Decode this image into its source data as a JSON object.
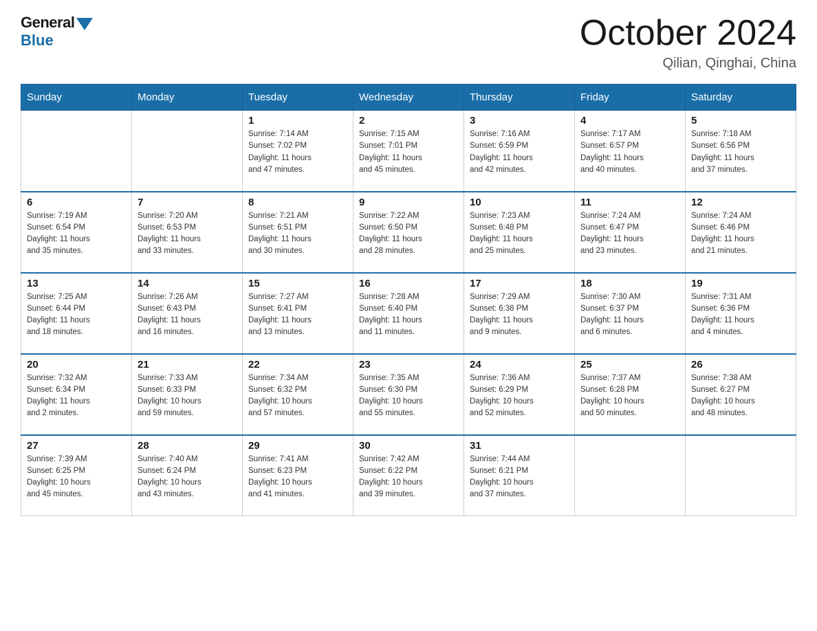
{
  "header": {
    "logo_general": "General",
    "logo_blue": "Blue",
    "month_title": "October 2024",
    "location": "Qilian, Qinghai, China"
  },
  "days_of_week": [
    "Sunday",
    "Monday",
    "Tuesday",
    "Wednesday",
    "Thursday",
    "Friday",
    "Saturday"
  ],
  "weeks": [
    [
      {
        "day": "",
        "info": ""
      },
      {
        "day": "",
        "info": ""
      },
      {
        "day": "1",
        "info": "Sunrise: 7:14 AM\nSunset: 7:02 PM\nDaylight: 11 hours\nand 47 minutes."
      },
      {
        "day": "2",
        "info": "Sunrise: 7:15 AM\nSunset: 7:01 PM\nDaylight: 11 hours\nand 45 minutes."
      },
      {
        "day": "3",
        "info": "Sunrise: 7:16 AM\nSunset: 6:59 PM\nDaylight: 11 hours\nand 42 minutes."
      },
      {
        "day": "4",
        "info": "Sunrise: 7:17 AM\nSunset: 6:57 PM\nDaylight: 11 hours\nand 40 minutes."
      },
      {
        "day": "5",
        "info": "Sunrise: 7:18 AM\nSunset: 6:56 PM\nDaylight: 11 hours\nand 37 minutes."
      }
    ],
    [
      {
        "day": "6",
        "info": "Sunrise: 7:19 AM\nSunset: 6:54 PM\nDaylight: 11 hours\nand 35 minutes."
      },
      {
        "day": "7",
        "info": "Sunrise: 7:20 AM\nSunset: 6:53 PM\nDaylight: 11 hours\nand 33 minutes."
      },
      {
        "day": "8",
        "info": "Sunrise: 7:21 AM\nSunset: 6:51 PM\nDaylight: 11 hours\nand 30 minutes."
      },
      {
        "day": "9",
        "info": "Sunrise: 7:22 AM\nSunset: 6:50 PM\nDaylight: 11 hours\nand 28 minutes."
      },
      {
        "day": "10",
        "info": "Sunrise: 7:23 AM\nSunset: 6:48 PM\nDaylight: 11 hours\nand 25 minutes."
      },
      {
        "day": "11",
        "info": "Sunrise: 7:24 AM\nSunset: 6:47 PM\nDaylight: 11 hours\nand 23 minutes."
      },
      {
        "day": "12",
        "info": "Sunrise: 7:24 AM\nSunset: 6:46 PM\nDaylight: 11 hours\nand 21 minutes."
      }
    ],
    [
      {
        "day": "13",
        "info": "Sunrise: 7:25 AM\nSunset: 6:44 PM\nDaylight: 11 hours\nand 18 minutes."
      },
      {
        "day": "14",
        "info": "Sunrise: 7:26 AM\nSunset: 6:43 PM\nDaylight: 11 hours\nand 16 minutes."
      },
      {
        "day": "15",
        "info": "Sunrise: 7:27 AM\nSunset: 6:41 PM\nDaylight: 11 hours\nand 13 minutes."
      },
      {
        "day": "16",
        "info": "Sunrise: 7:28 AM\nSunset: 6:40 PM\nDaylight: 11 hours\nand 11 minutes."
      },
      {
        "day": "17",
        "info": "Sunrise: 7:29 AM\nSunset: 6:38 PM\nDaylight: 11 hours\nand 9 minutes."
      },
      {
        "day": "18",
        "info": "Sunrise: 7:30 AM\nSunset: 6:37 PM\nDaylight: 11 hours\nand 6 minutes."
      },
      {
        "day": "19",
        "info": "Sunrise: 7:31 AM\nSunset: 6:36 PM\nDaylight: 11 hours\nand 4 minutes."
      }
    ],
    [
      {
        "day": "20",
        "info": "Sunrise: 7:32 AM\nSunset: 6:34 PM\nDaylight: 11 hours\nand 2 minutes."
      },
      {
        "day": "21",
        "info": "Sunrise: 7:33 AM\nSunset: 6:33 PM\nDaylight: 10 hours\nand 59 minutes."
      },
      {
        "day": "22",
        "info": "Sunrise: 7:34 AM\nSunset: 6:32 PM\nDaylight: 10 hours\nand 57 minutes."
      },
      {
        "day": "23",
        "info": "Sunrise: 7:35 AM\nSunset: 6:30 PM\nDaylight: 10 hours\nand 55 minutes."
      },
      {
        "day": "24",
        "info": "Sunrise: 7:36 AM\nSunset: 6:29 PM\nDaylight: 10 hours\nand 52 minutes."
      },
      {
        "day": "25",
        "info": "Sunrise: 7:37 AM\nSunset: 6:28 PM\nDaylight: 10 hours\nand 50 minutes."
      },
      {
        "day": "26",
        "info": "Sunrise: 7:38 AM\nSunset: 6:27 PM\nDaylight: 10 hours\nand 48 minutes."
      }
    ],
    [
      {
        "day": "27",
        "info": "Sunrise: 7:39 AM\nSunset: 6:25 PM\nDaylight: 10 hours\nand 45 minutes."
      },
      {
        "day": "28",
        "info": "Sunrise: 7:40 AM\nSunset: 6:24 PM\nDaylight: 10 hours\nand 43 minutes."
      },
      {
        "day": "29",
        "info": "Sunrise: 7:41 AM\nSunset: 6:23 PM\nDaylight: 10 hours\nand 41 minutes."
      },
      {
        "day": "30",
        "info": "Sunrise: 7:42 AM\nSunset: 6:22 PM\nDaylight: 10 hours\nand 39 minutes."
      },
      {
        "day": "31",
        "info": "Sunrise: 7:44 AM\nSunset: 6:21 PM\nDaylight: 10 hours\nand 37 minutes."
      },
      {
        "day": "",
        "info": ""
      },
      {
        "day": "",
        "info": ""
      }
    ]
  ]
}
